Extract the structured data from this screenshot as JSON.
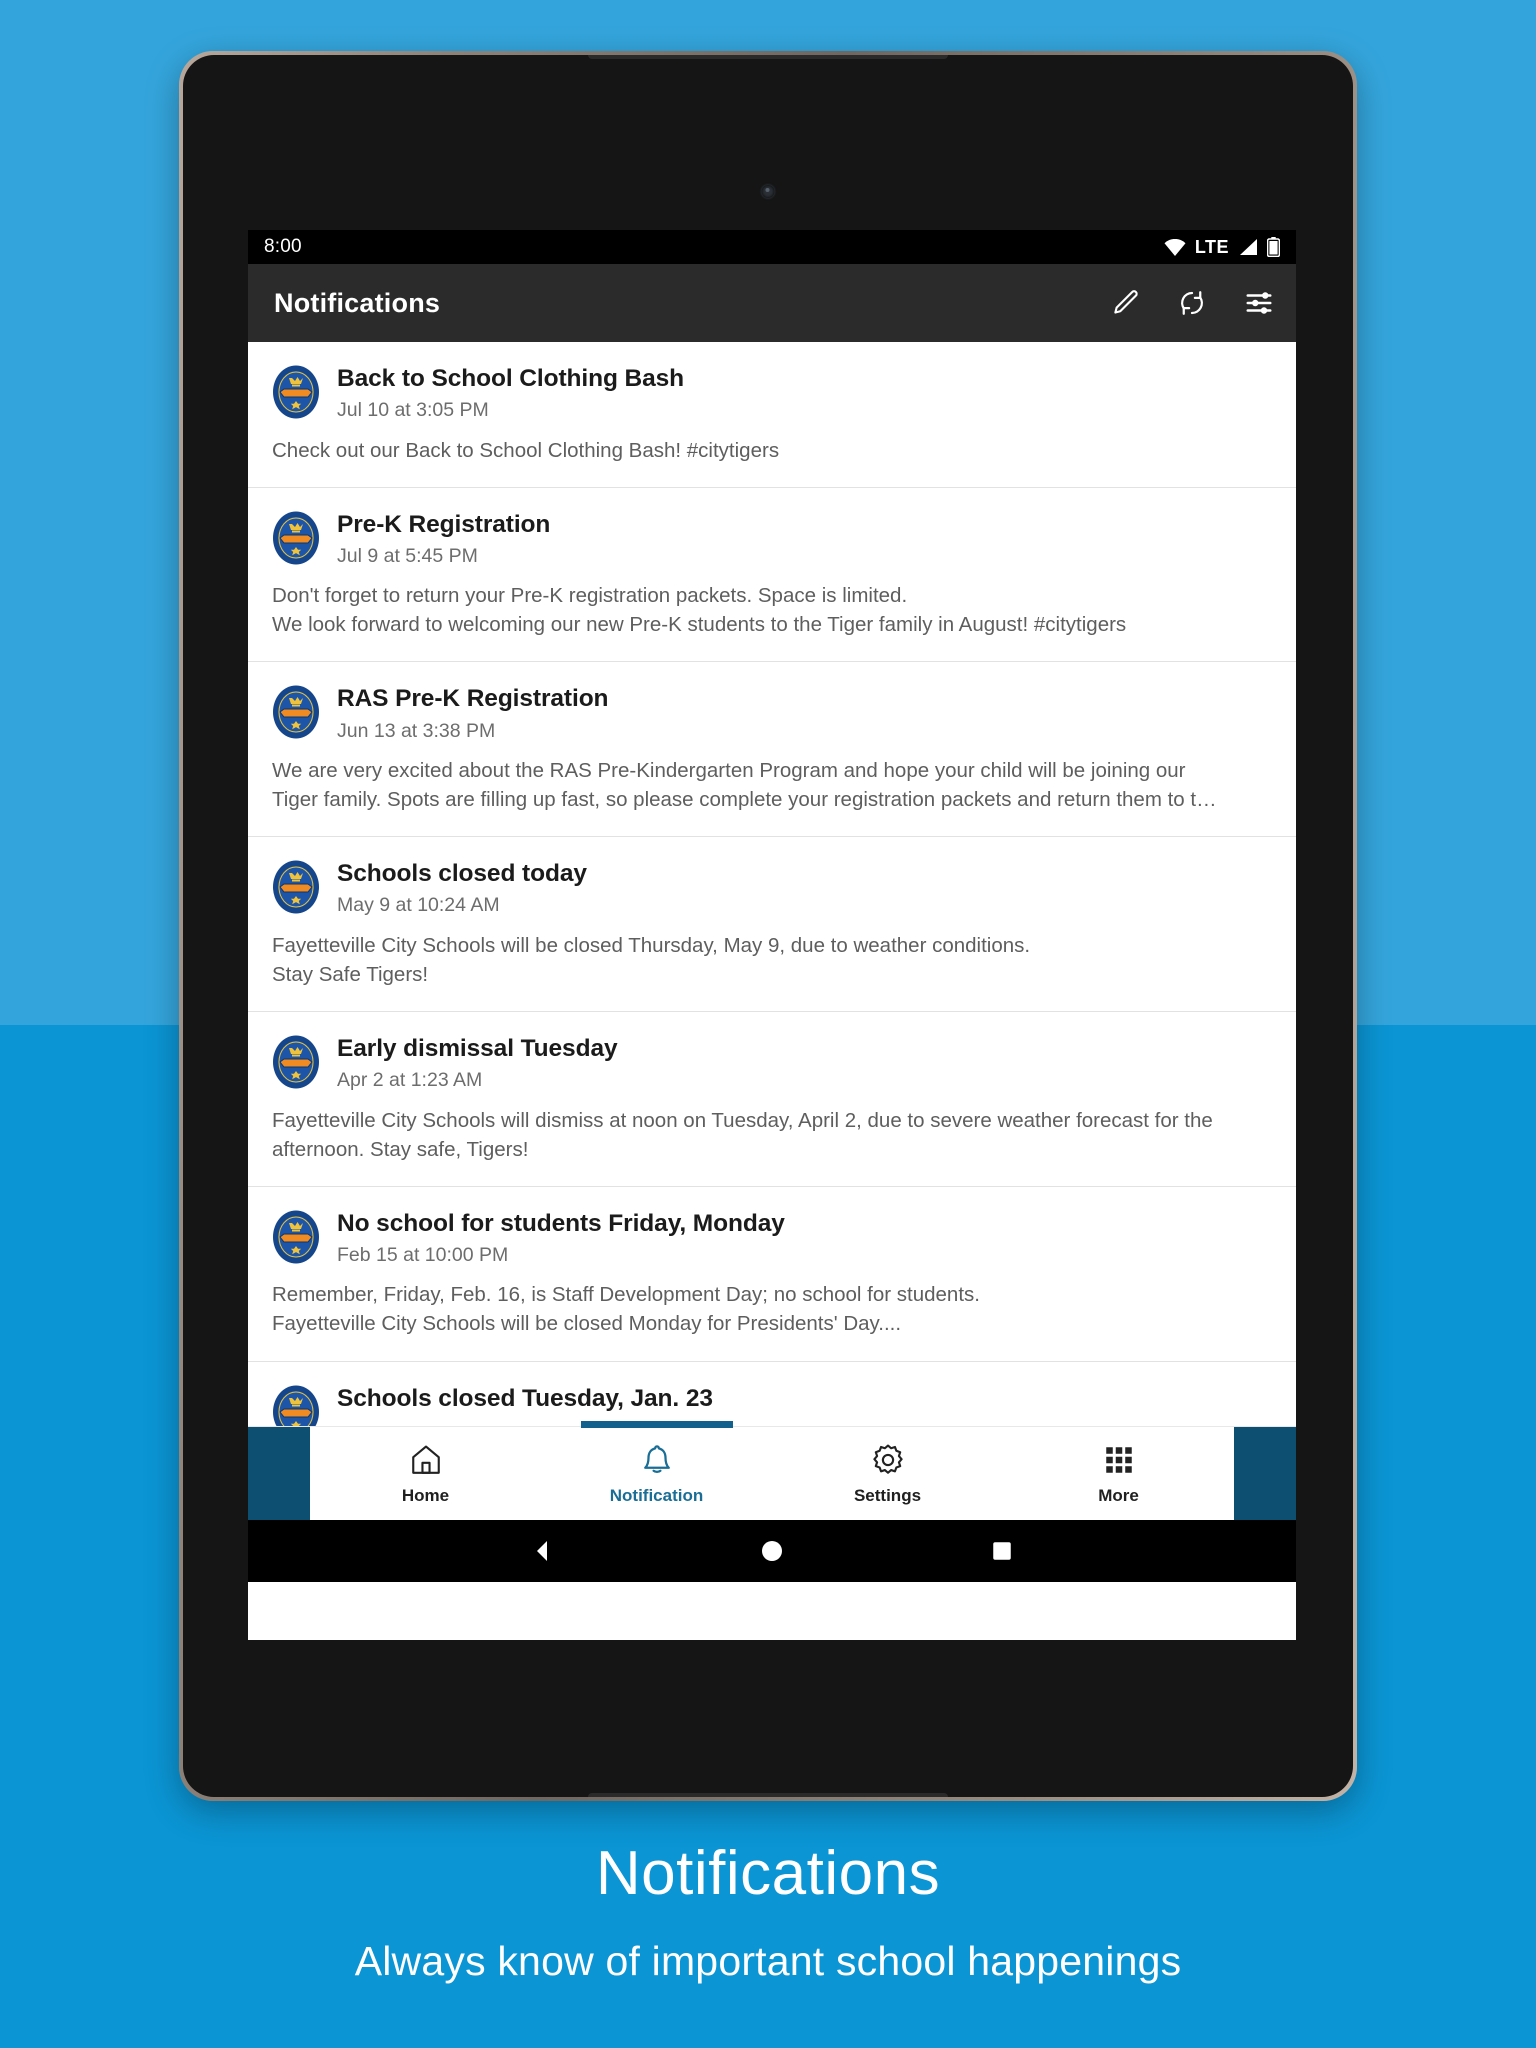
{
  "background": {
    "top_color": "#34a5dc",
    "bottom_color": "#0b95d4"
  },
  "caption": {
    "title": "Notifications",
    "subtitle": "Always know of important school happenings"
  },
  "statusbar": {
    "time": "8:00",
    "network_label": "LTE",
    "icons": [
      "wifi-icon",
      "signal-icon",
      "battery-icon"
    ]
  },
  "appbar": {
    "title": "Notifications",
    "actions": [
      {
        "name": "compose-icon",
        "label": "Compose"
      },
      {
        "name": "refresh-icon",
        "label": "Refresh"
      },
      {
        "name": "filter-icon",
        "label": "Filter"
      }
    ]
  },
  "notifications": [
    {
      "title": "Back to School Clothing Bash",
      "date": "Jul 10 at 3:05 PM",
      "body": [
        "Check out our Back to School Clothing Bash! #citytigers"
      ]
    },
    {
      "title": "Pre-K Registration",
      "date": "Jul 9 at 5:45 PM",
      "body": [
        "Don't forget to return your Pre-K registration packets. Space is limited.",
        "We look forward to welcoming our new Pre-K students to the Tiger family in August! #citytigers"
      ]
    },
    {
      "title": "RAS Pre-K Registration",
      "date": "Jun 13 at 3:38 PM",
      "body": [
        "We are very excited about the RAS Pre-Kindergarten Program and hope your child will be joining our",
        "Tiger family. Spots are filling up fast, so please complete your registration packets and return them to t…"
      ]
    },
    {
      "title": "Schools closed today",
      "date": "May 9 at 10:24 AM",
      "body": [
        "Fayetteville City Schools will be closed Thursday, May 9, due to weather conditions.",
        "Stay Safe Tigers!"
      ]
    },
    {
      "title": "Early dismissal Tuesday",
      "date": "Apr 2 at 1:23 AM",
      "body": [
        "Fayetteville City Schools will dismiss at noon on Tuesday, April 2, due to severe weather forecast for the",
        "afternoon. Stay safe, Tigers!"
      ]
    },
    {
      "title": "No school for students Friday, Monday",
      "date": "Feb 15 at 10:00 PM",
      "body": [
        "Remember, Friday, Feb. 16, is Staff Development Day; no school for students.",
        "Fayetteville City Schools will be closed Monday for Presidents' Day...."
      ]
    },
    {
      "title": "Schools closed Tuesday, Jan. 23",
      "date": "",
      "body": []
    }
  ],
  "bottom_nav": {
    "active_color": "#1a6e96",
    "items": [
      {
        "label": "Home",
        "icon": "home-icon",
        "active": false
      },
      {
        "label": "Notification",
        "icon": "bell-icon",
        "active": true
      },
      {
        "label": "Settings",
        "icon": "gear-icon",
        "active": false
      },
      {
        "label": "More",
        "icon": "grid-icon",
        "active": false
      }
    ]
  },
  "system_nav": {
    "items": [
      {
        "name": "back-button"
      },
      {
        "name": "home-button"
      },
      {
        "name": "recents-button"
      }
    ]
  }
}
